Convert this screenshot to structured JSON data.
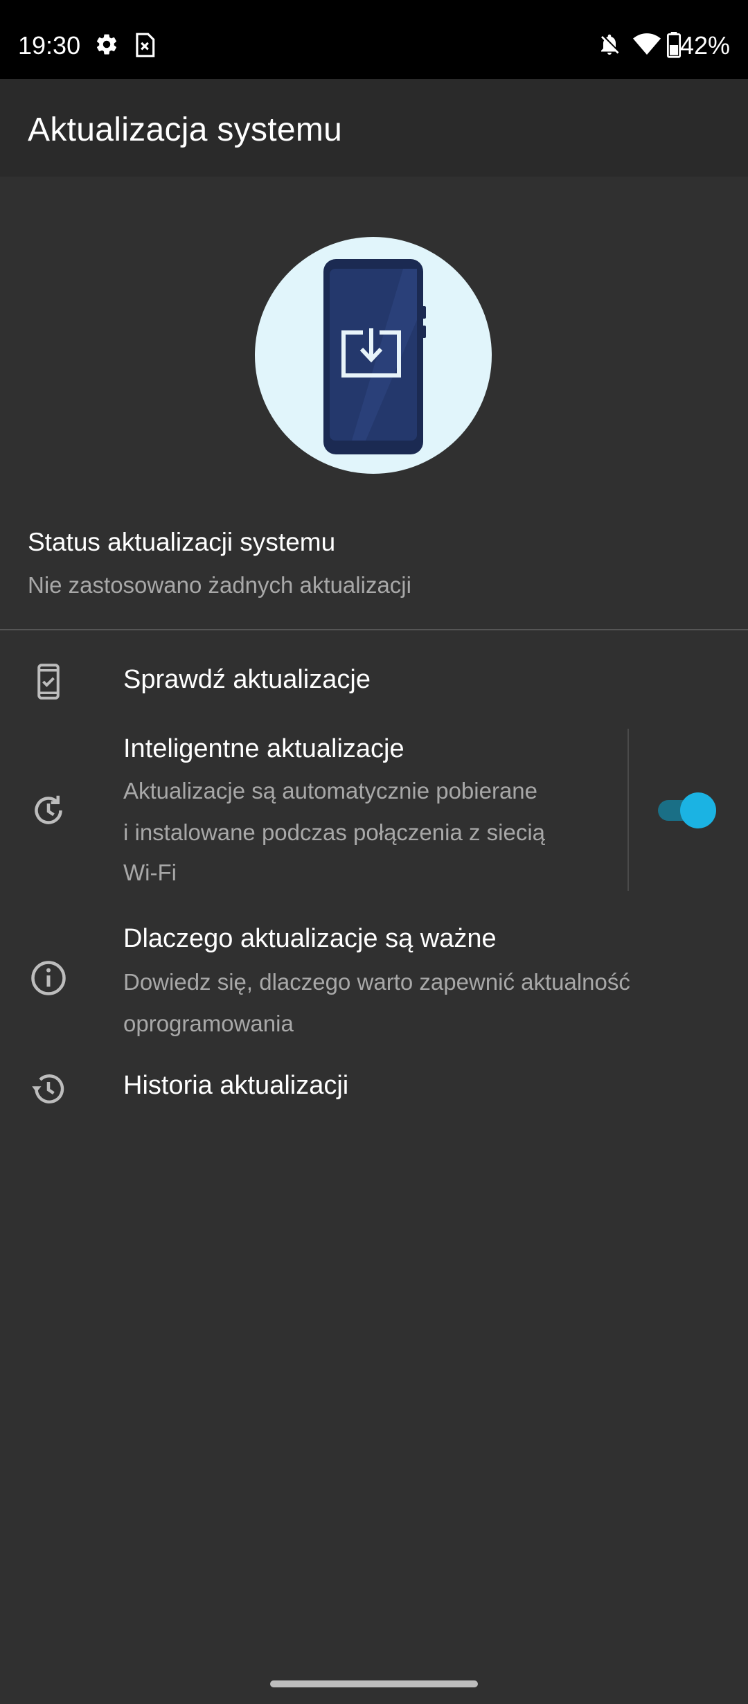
{
  "status_bar": {
    "time": "19:30",
    "battery_percent": "42%",
    "icons": [
      "gear-icon",
      "sim-card-icon",
      "notifications-off-icon",
      "wifi-icon",
      "battery-icon"
    ]
  },
  "app_bar": {
    "title": "Aktualizacja systemu"
  },
  "hero": {
    "icon": "phone-download-illustration",
    "circle_color": "#e1f5fb",
    "phone_color": "#1b2a52"
  },
  "update_status": {
    "title": "Status aktualizacji systemu",
    "subtitle": "Nie zastosowano żadnych aktualizacji"
  },
  "items": [
    {
      "icon": "phone-check-icon",
      "title": "Sprawdź aktualizacje"
    },
    {
      "icon": "update-clock-icon",
      "title": "Inteligentne aktualizacje",
      "subtitle_lines": [
        "Aktualizacje są automatycznie pobierane",
        "i instalowane podczas połączenia z siecią",
        "Wi-Fi"
      ],
      "toggle_on": true
    },
    {
      "icon": "info-icon",
      "title": "Dlaczego aktualizacje są ważne",
      "subtitle_lines": [
        "Dowiedz się, dlaczego warto zapewnić aktualność",
        "oprogramowania"
      ]
    },
    {
      "icon": "history-icon",
      "title": "Historia aktualizacji"
    }
  ],
  "colors": {
    "background": "#303030",
    "app_bar": "#2a2a2a",
    "accent": "#1bb3e3"
  }
}
